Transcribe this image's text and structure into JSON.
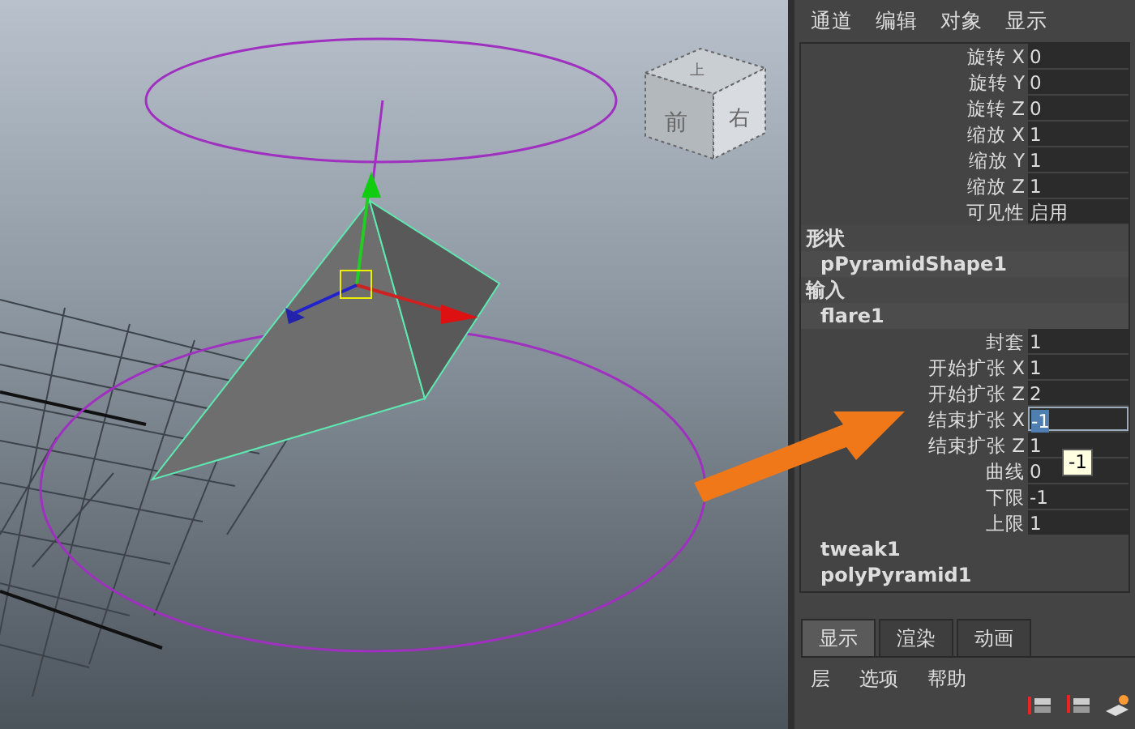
{
  "menu": [
    "通道",
    "编辑",
    "对象",
    "显示"
  ],
  "viewcube": {
    "faces": [
      "上",
      "前",
      "右"
    ]
  },
  "attributes": [
    {
      "kind": "field",
      "label": "旋转 X",
      "value": "0",
      "selected": false
    },
    {
      "kind": "field",
      "label": "旋转 Y",
      "value": "0",
      "selected": false
    },
    {
      "kind": "field",
      "label": "旋转 Z",
      "value": "0",
      "selected": false
    },
    {
      "kind": "field",
      "label": "缩放 X",
      "value": "1",
      "selected": false
    },
    {
      "kind": "field",
      "label": "缩放 Y",
      "value": "1",
      "selected": false
    },
    {
      "kind": "field",
      "label": "缩放 Z",
      "value": "1",
      "selected": false
    },
    {
      "kind": "field",
      "label": "可见性",
      "value": "启用",
      "selected": false
    },
    {
      "kind": "header",
      "label": "形状"
    },
    {
      "kind": "node",
      "label": "pPyramidShape1"
    },
    {
      "kind": "header",
      "label": "输入"
    },
    {
      "kind": "node",
      "label": "flare1"
    },
    {
      "kind": "field",
      "label": "封套",
      "value": "1",
      "selected": false
    },
    {
      "kind": "field",
      "label": "开始扩张 X",
      "value": "1",
      "selected": false
    },
    {
      "kind": "field",
      "label": "开始扩张 Z",
      "value": "2",
      "selected": false
    },
    {
      "kind": "field",
      "label": "结束扩张 X",
      "value": "-1",
      "selected": true
    },
    {
      "kind": "field",
      "label": "结束扩张 Z",
      "value": "1",
      "selected": false
    },
    {
      "kind": "field",
      "label": "曲线",
      "value": "0",
      "selected": false
    },
    {
      "kind": "field",
      "label": "下限",
      "value": "-1",
      "selected": false
    },
    {
      "kind": "field",
      "label": "上限",
      "value": "1",
      "selected": false
    },
    {
      "kind": "plain",
      "label": "tweak1"
    },
    {
      "kind": "plain",
      "label": "polyPyramid1"
    }
  ],
  "tooltip": "-1",
  "tabs": [
    {
      "label": "显示",
      "selected": true
    },
    {
      "label": "渲染",
      "selected": false
    },
    {
      "label": "动画",
      "selected": false
    }
  ],
  "bottom_menu": [
    "层",
    "选项",
    "帮助"
  ]
}
